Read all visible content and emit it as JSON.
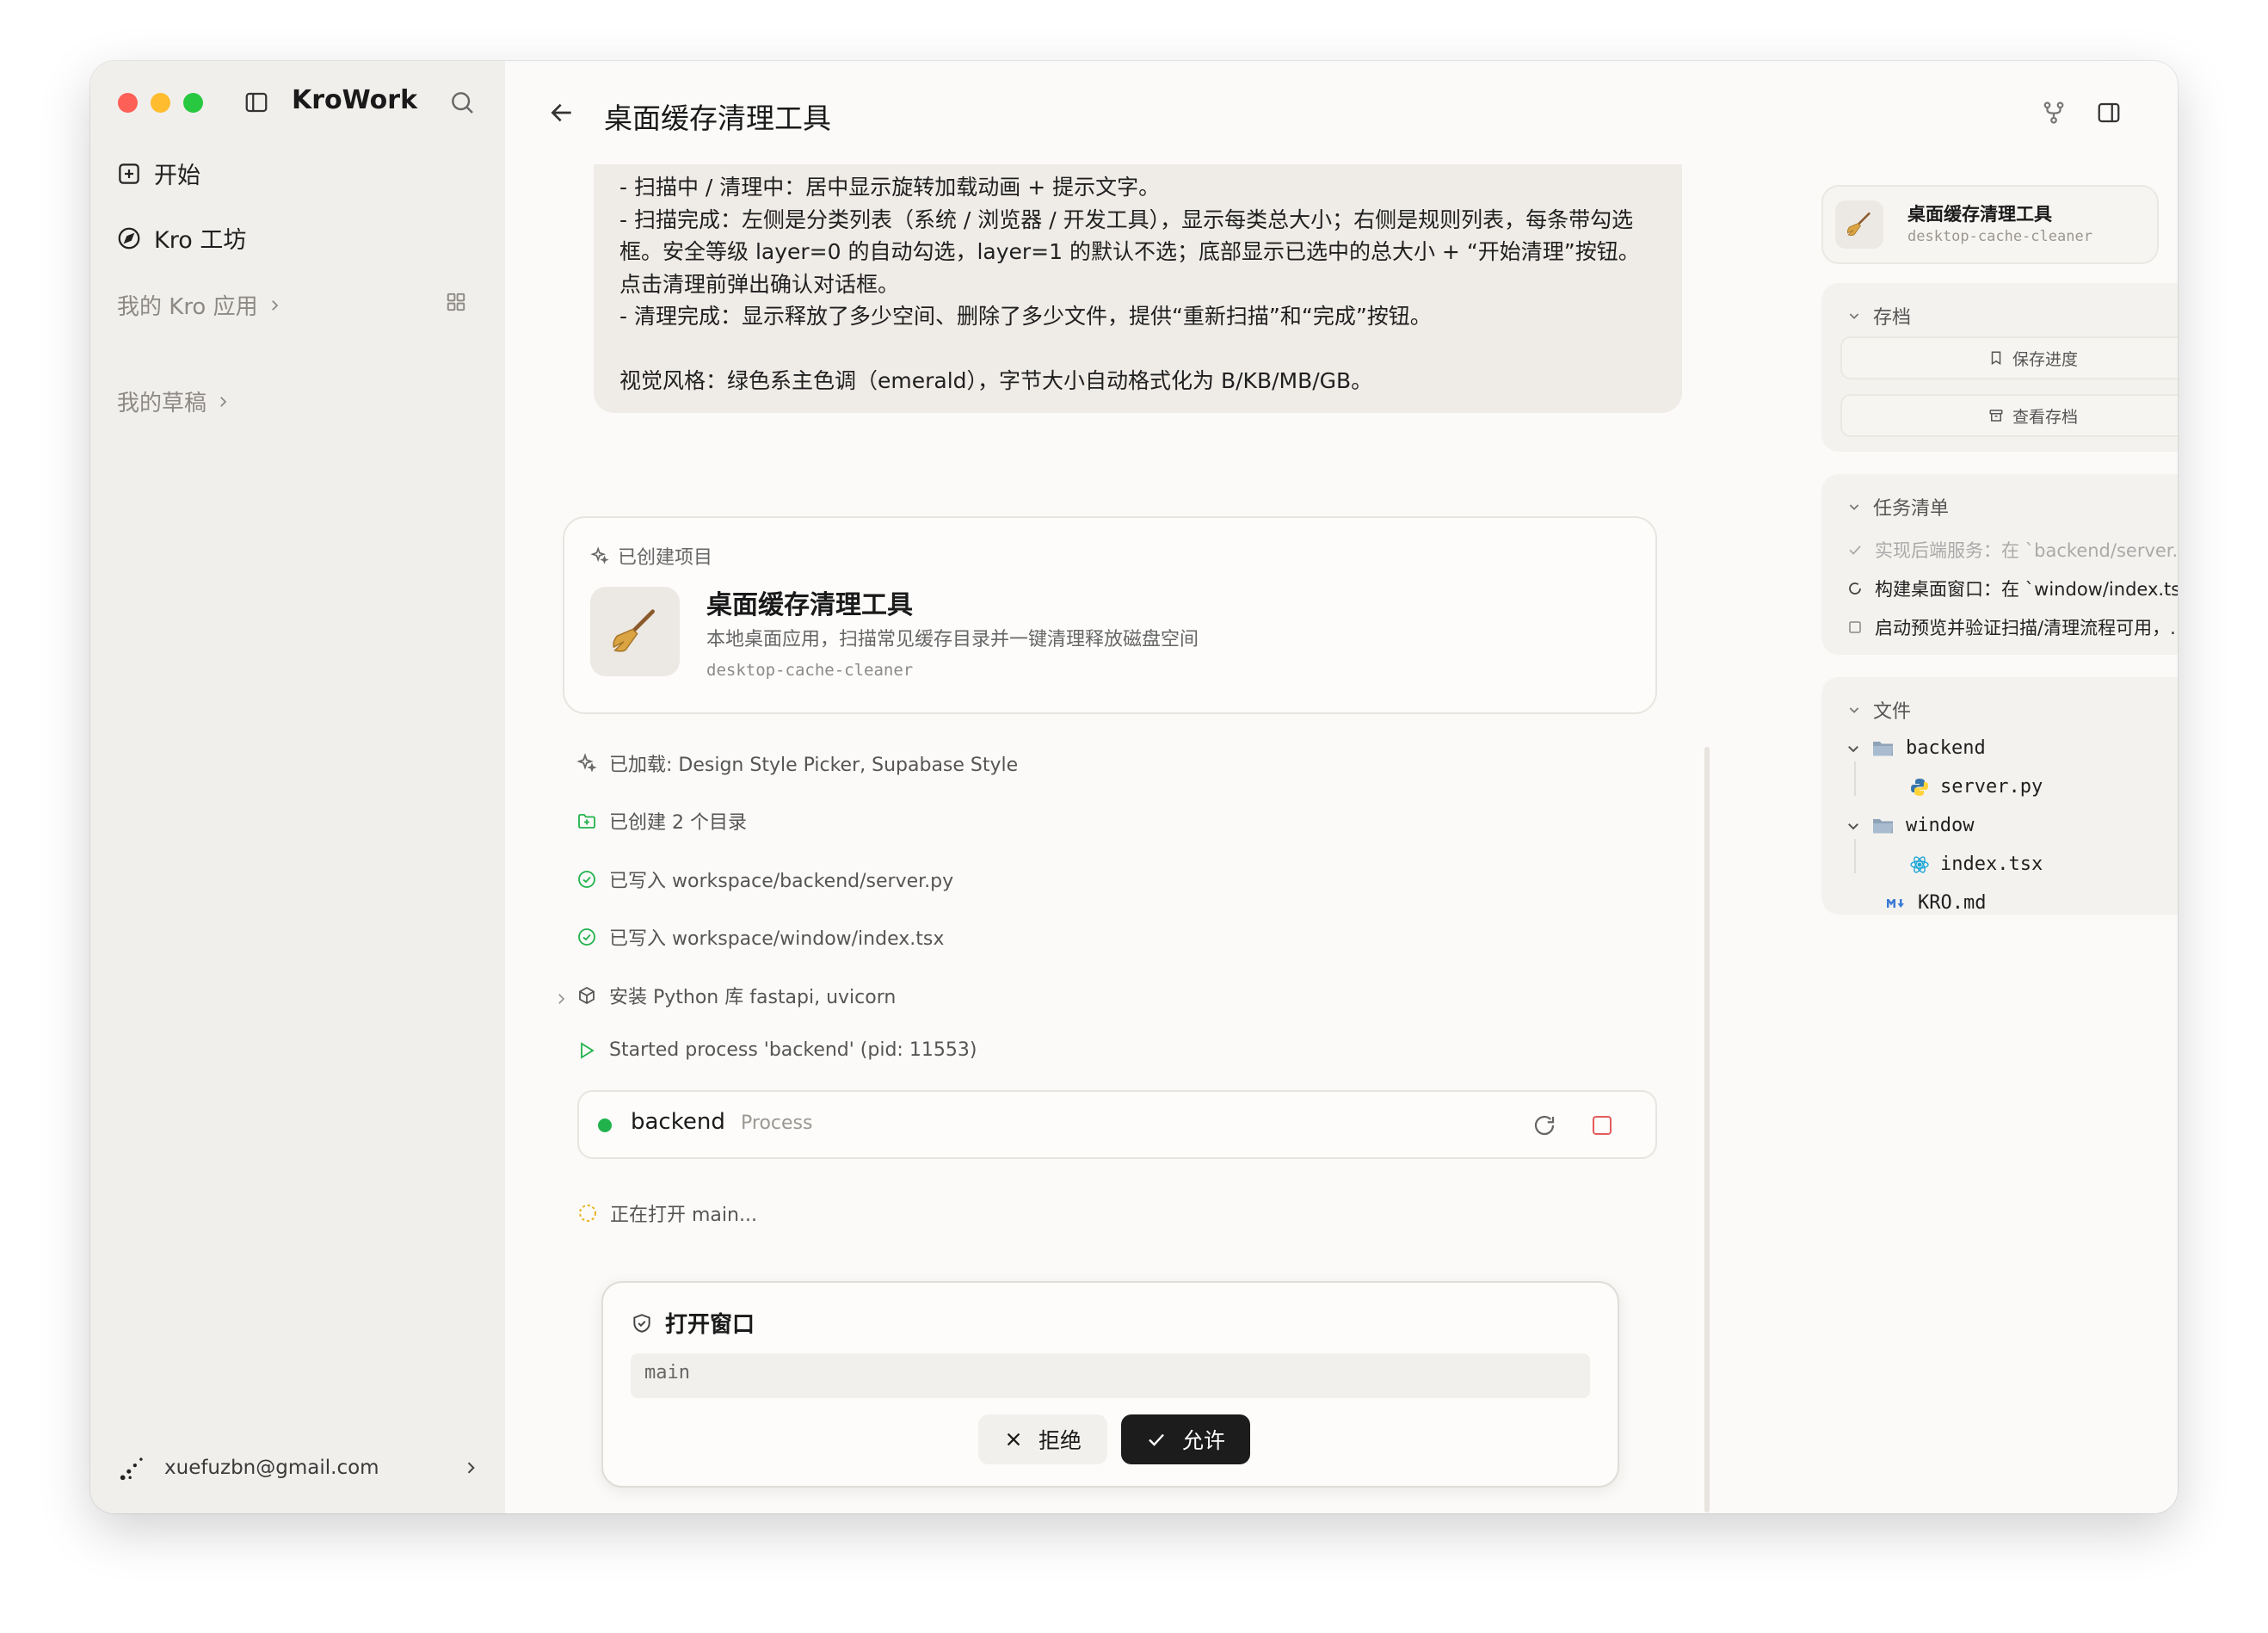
{
  "app": {
    "title": "KroWork"
  },
  "sidebar": {
    "items": [
      {
        "label": "开始",
        "icon": "plus-square-icon"
      },
      {
        "label": "Kro 工坊",
        "icon": "compass-icon"
      }
    ],
    "groups": [
      {
        "label": "我的 Kro 应用"
      },
      {
        "label": "我的草稿"
      }
    ],
    "user": {
      "email": "xuefuzbn@gmail.com"
    }
  },
  "header": {
    "title": "桌面缓存清理工具"
  },
  "message": {
    "text": "- 扫描中 / 清理中：居中显示旋转加载动画 + 提示文字。\n- 扫描完成：左侧是分类列表（系统 / 浏览器 / 开发工具），显示每类总大小；右侧是规则列表，每条带勾选框。安全等级 layer=0 的自动勾选，layer=1 的默认不选；底部显示已选中的总大小 + “开始清理”按钮。点击清理前弹出确认对话框。\n- 清理完成：显示释放了多少空间、删除了多少文件，提供“重新扫描”和“完成”按钮。\n\n视觉风格：绿色系主色调（emerald），字节大小自动格式化为 B/KB/MB/GB。"
  },
  "project": {
    "label": "已创建项目",
    "name": "桌面缓存清理工具",
    "description": "本地桌面应用，扫描常见缓存目录并一键清理释放磁盘空间",
    "slug": "desktop-cache-cleaner"
  },
  "activities": [
    {
      "text": "已加载: Design Style Picker, Supabase Style",
      "icon": "sparkle-icon"
    },
    {
      "text": "已创建 2 个目录",
      "icon": "folder-plus-icon"
    },
    {
      "text": "已写入 workspace/backend/server.py",
      "icon": "check-circle-icon"
    },
    {
      "text": "已写入 workspace/window/index.tsx",
      "icon": "check-circle-icon"
    },
    {
      "text": "安装 Python 库 fastapi, uvicorn",
      "icon": "package-icon"
    },
    {
      "text": "Started process 'backend' (pid: 11553)",
      "icon": "play-icon"
    }
  ],
  "process": {
    "name": "backend",
    "type": "Process",
    "status_color": "#22b24c"
  },
  "opening": {
    "text": "正在打开 main..."
  },
  "dialog": {
    "title": "打开窗口",
    "value": "main",
    "deny_label": "拒绝",
    "allow_label": "允许"
  },
  "right_panel": {
    "project_name": "桌面缓存清理工具",
    "project_slug": "desktop-cache-cleaner",
    "archive": {
      "title": "存档",
      "save_label": "保存进度",
      "view_label": "查看存档"
    },
    "tasks": {
      "title": "任务清单",
      "items": [
        {
          "text": "实现后端服务：在 `backend/server....",
          "status": "done"
        },
        {
          "text": "构建桌面窗口：在 `window/index.tsx...",
          "status": "in-progress"
        },
        {
          "text": "启动预览并验证扫描/清理流程可用，...",
          "status": "todo"
        }
      ]
    },
    "files": {
      "title": "文件",
      "tree": [
        {
          "name": "backend",
          "type": "folder"
        },
        {
          "name": "server.py",
          "type": "python-file"
        },
        {
          "name": "window",
          "type": "folder"
        },
        {
          "name": "index.tsx",
          "type": "react-file"
        },
        {
          "name": "KRO.md",
          "type": "markdown-file"
        }
      ]
    }
  },
  "colors": {
    "accent_green": "#22b24c",
    "stop_red": "#e45b5b",
    "sidebar_bg": "#f1efec",
    "main_bg": "#fbfaf8"
  }
}
